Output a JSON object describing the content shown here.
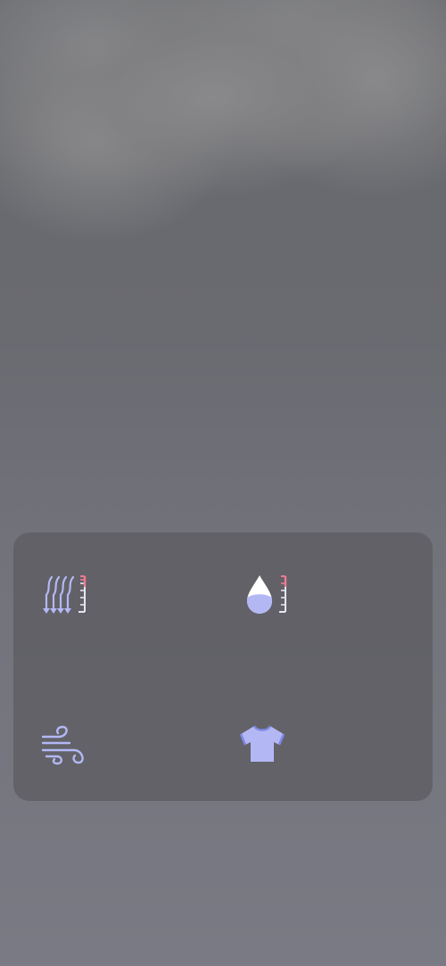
{
  "background": {
    "sky_color": "#6a6b71",
    "cloud_color": "#8a8a8c"
  },
  "details_card": {
    "background_color": "#5c5c62",
    "items": [
      {
        "icon": "pressure-icon",
        "accent": "#b3b8f5"
      },
      {
        "icon": "humidity-icon",
        "accent": "#b3b8f5"
      },
      {
        "icon": "wind-icon",
        "accent": "#b3b8f5"
      },
      {
        "icon": "clothing-icon",
        "accent": "#b3b8f5"
      }
    ]
  }
}
